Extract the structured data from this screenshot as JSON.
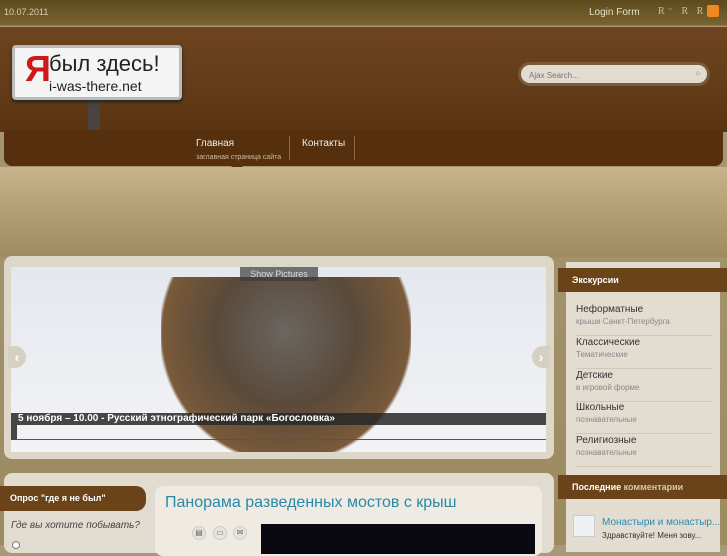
{
  "topbar": {
    "date": "10.07.2011",
    "login": "Login Form",
    "font_size_controls": "R⁻ R R⁺",
    "rss_icon": "rss-icon"
  },
  "logo": {
    "letter": "Я",
    "line1": "был здесь!",
    "line2": "i-was-there.net"
  },
  "search": {
    "placeholder": "Ajax Search..."
  },
  "nav": [
    {
      "label": "Главная",
      "sub": "заглавная страница сайта"
    },
    {
      "label": "Контакты"
    }
  ],
  "slider": {
    "show_pictures": "Show Pictures",
    "caption": "5 ноября – 10.00 - Русский этнографический парк «Богословка»",
    "prev": "‹",
    "next": "›"
  },
  "sidebar": {
    "excursions_title": "Экскурсии",
    "items": [
      {
        "title": "Неформатные",
        "sub": "крыши Санкт-Петербурга"
      },
      {
        "title": "Классические",
        "sub": "Тематические"
      },
      {
        "title": "Детские",
        "sub": "в игровой форме"
      },
      {
        "title": "Школьные",
        "sub": "познавательные"
      },
      {
        "title": "Религиозные",
        "sub": "познавательные"
      }
    ],
    "comments_title_a": "Последние",
    "comments_title_b": "комментарии",
    "comment": {
      "title": "Монастыри и монастыр...",
      "text": "Здравствуйте! Меня зову..."
    }
  },
  "poll": {
    "title": "Опрос \"где я не был\"",
    "question": "Где вы хотите побывать?"
  },
  "article": {
    "title": "Панорама разведенных мостов с крыш"
  }
}
